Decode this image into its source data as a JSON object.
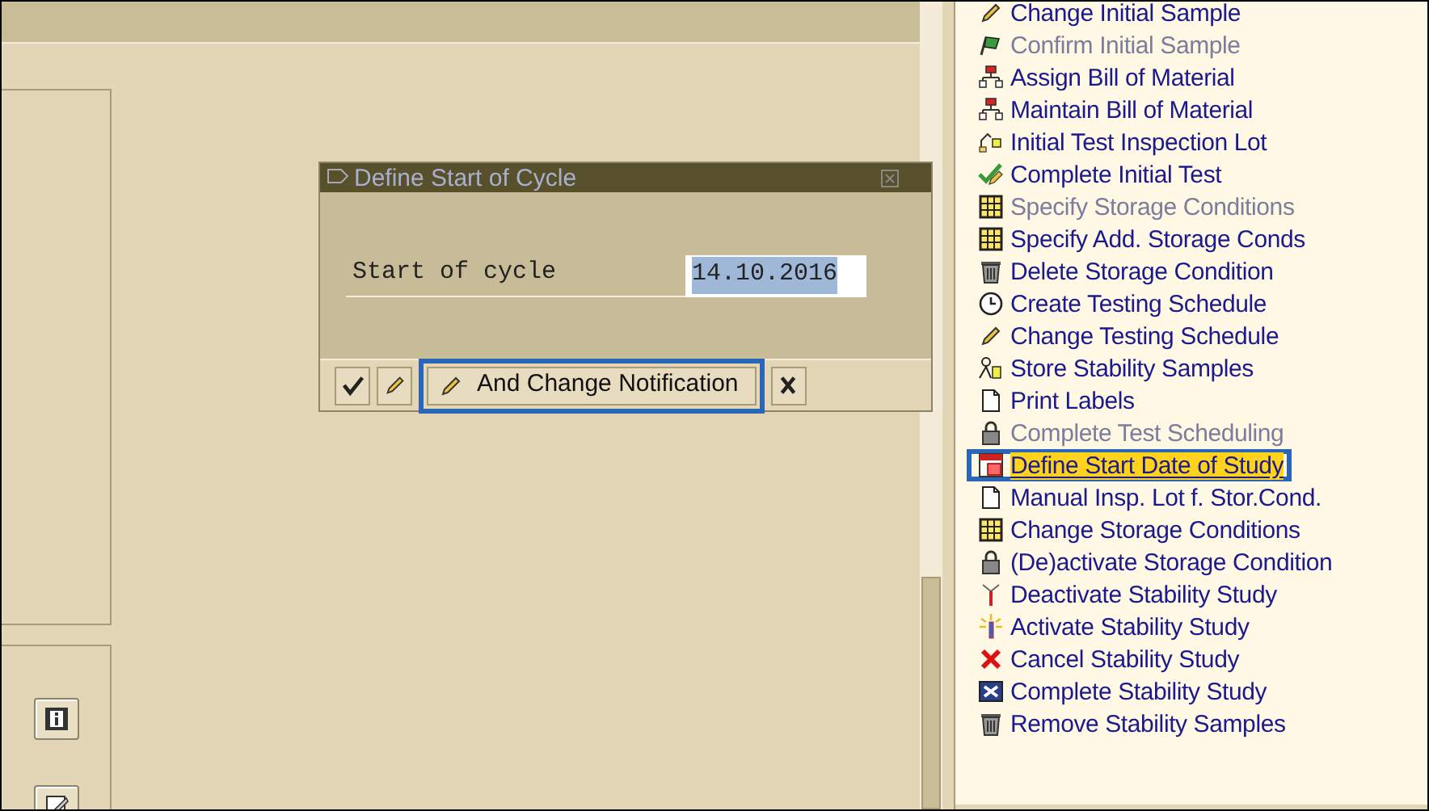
{
  "dialog": {
    "title": "Define Start of Cycle",
    "field": {
      "label": "Start of cycle",
      "value": "14.10.2016"
    },
    "buttons": [
      {
        "kind": "check",
        "highlighted": false
      },
      {
        "kind": "pencil",
        "highlighted": false
      },
      {
        "kind": "pencil",
        "label": "And Change Notification",
        "highlighted": true
      },
      {
        "kind": "cancel",
        "highlighted": false
      }
    ]
  },
  "left_panel": {
    "buttons": [
      {
        "kind": "info"
      },
      {
        "kind": "edit"
      }
    ]
  },
  "menu": [
    {
      "kind": "pencil",
      "label": "Change Initial Sample",
      "disabled": false,
      "selected": false
    },
    {
      "kind": "flag",
      "label": "Confirm Initial Sample",
      "disabled": true,
      "selected": false
    },
    {
      "kind": "hierarchy",
      "label": "Assign Bill of Material",
      "disabled": false,
      "selected": false
    },
    {
      "kind": "hierarchy",
      "label": "Maintain Bill of Material",
      "disabled": false,
      "selected": false
    },
    {
      "kind": "lot",
      "label": "Initial Test Inspection Lot",
      "disabled": false,
      "selected": false
    },
    {
      "kind": "checkpencil",
      "label": "Complete Initial Test",
      "disabled": false,
      "selected": false
    },
    {
      "kind": "grid",
      "label": "Specify Storage Conditions",
      "disabled": true,
      "selected": false
    },
    {
      "kind": "grid",
      "label": "Specify Add. Storage Conds",
      "disabled": false,
      "selected": false
    },
    {
      "kind": "trash",
      "label": "Delete Storage Condition",
      "disabled": false,
      "selected": false
    },
    {
      "kind": "clock",
      "label": "Create Testing Schedule",
      "disabled": false,
      "selected": false
    },
    {
      "kind": "pencil",
      "label": "Change Testing Schedule",
      "disabled": false,
      "selected": false
    },
    {
      "kind": "person",
      "label": "Store Stability Samples",
      "disabled": false,
      "selected": false
    },
    {
      "kind": "document",
      "label": "Print Labels",
      "disabled": false,
      "selected": false
    },
    {
      "kind": "lock",
      "label": "Complete Test Scheduling",
      "disabled": true,
      "selected": false
    },
    {
      "kind": "calendar",
      "label": "Define Start Date of Study",
      "disabled": false,
      "selected": true
    },
    {
      "kind": "document",
      "label": "Manual Insp. Lot f. Stor.Cond.",
      "disabled": false,
      "selected": false
    },
    {
      "kind": "grid",
      "label": "Change Storage Conditions",
      "disabled": false,
      "selected": false
    },
    {
      "kind": "lock",
      "label": "(De)activate Storage Condition",
      "disabled": false,
      "selected": false
    },
    {
      "kind": "antenna",
      "label": "Deactivate Stability Study",
      "disabled": false,
      "selected": false
    },
    {
      "kind": "spark",
      "label": "Activate Stability Study",
      "disabled": false,
      "selected": false
    },
    {
      "kind": "cross",
      "label": "Cancel Stability Study",
      "disabled": false,
      "selected": false
    },
    {
      "kind": "boxx",
      "label": "Complete Stability Study",
      "disabled": false,
      "selected": false
    },
    {
      "kind": "trash",
      "label": "Remove Stability Samples",
      "disabled": false,
      "selected": false
    }
  ]
}
